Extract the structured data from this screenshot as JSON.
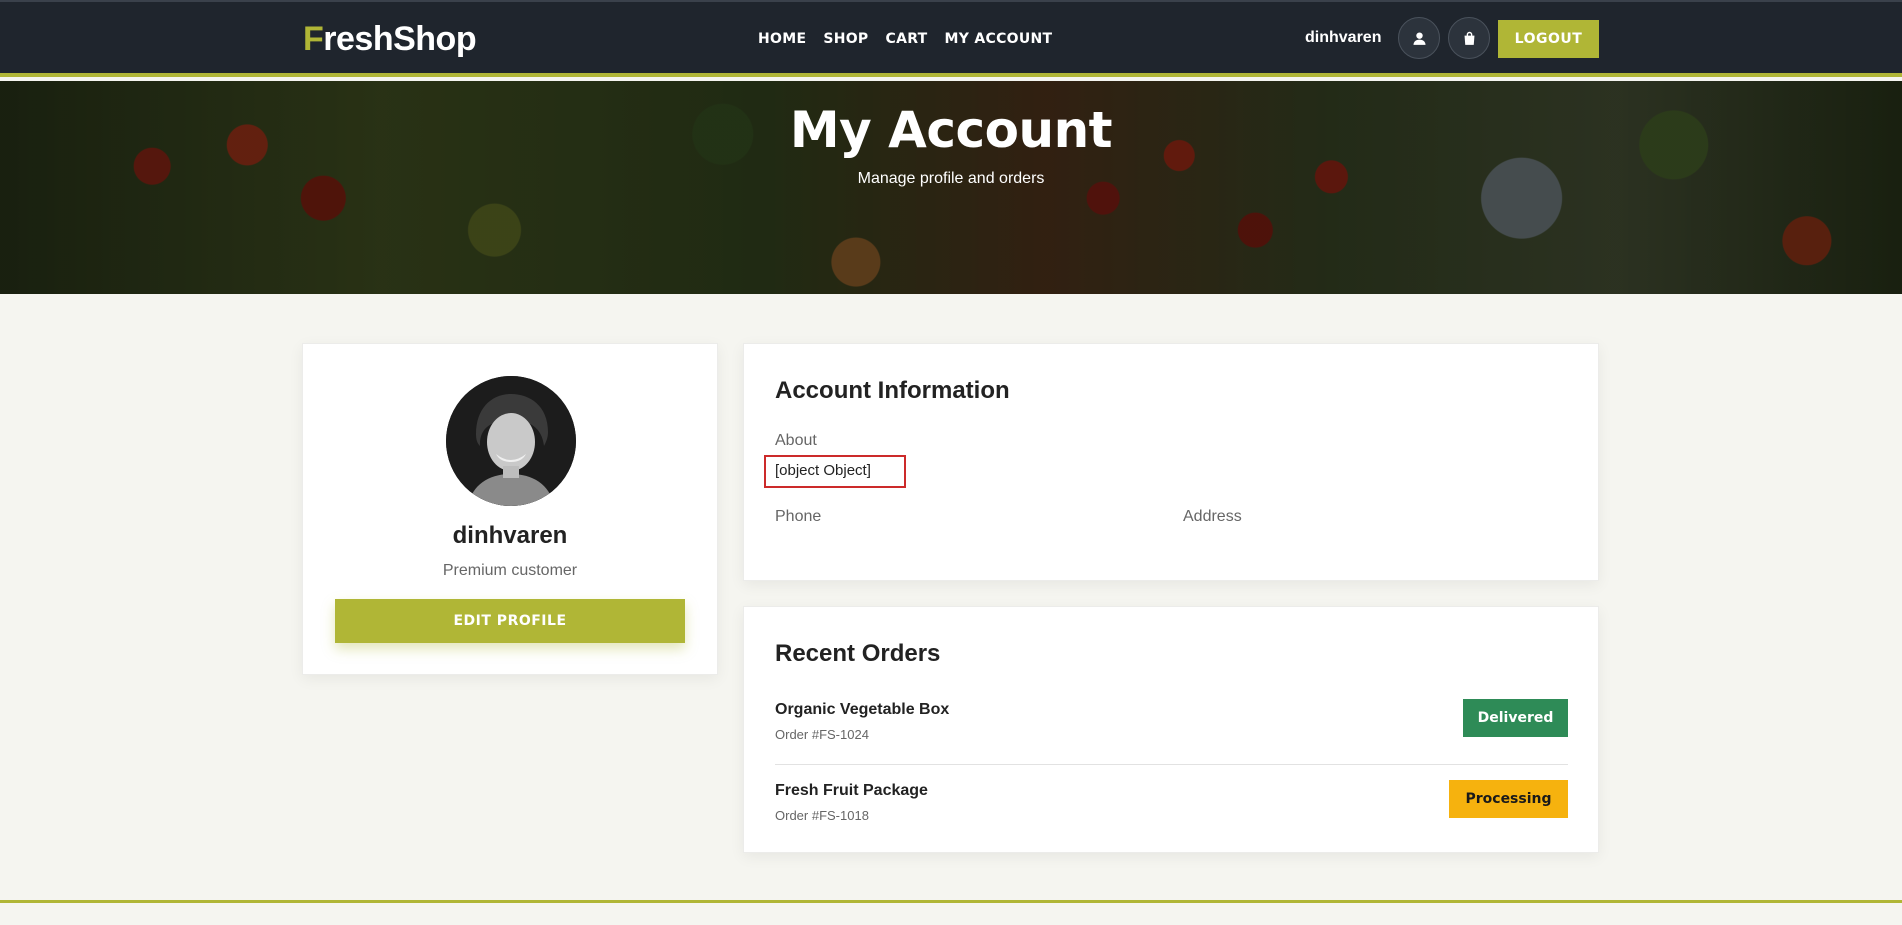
{
  "brand": {
    "logo_first_letter": "F",
    "logo_rest": "reshShop",
    "accent_color": "#b0b636",
    "dark_color": "#1f252d"
  },
  "nav": {
    "items": [
      {
        "label": "HOME"
      },
      {
        "label": "SHOP"
      },
      {
        "label": "CART"
      },
      {
        "label": "MY ACCOUNT"
      }
    ],
    "username": "dinhvaren",
    "user_icon": "user-icon",
    "bag_icon": "shopping-bag-icon",
    "logout_label": "LOGOUT"
  },
  "hero": {
    "title": "My Account",
    "subtitle": "Manage profile and orders"
  },
  "profile": {
    "name": "dinhvaren",
    "role": "Premium customer",
    "edit_label": "EDIT PROFILE"
  },
  "account_info": {
    "title": "Account Information",
    "about_label": "About",
    "about_value": "[object Object]",
    "phone_label": "Phone",
    "address_label": "Address"
  },
  "orders": {
    "title": "Recent Orders",
    "items": [
      {
        "name": "Organic Vegetable Box",
        "id": "Order #FS-1024",
        "status": "Delivered",
        "status_color": "#2e8b57"
      },
      {
        "name": "Fresh Fruit Package",
        "id": "Order #FS-1018",
        "status": "Processing",
        "status_color": "#f6b20e"
      }
    ]
  }
}
